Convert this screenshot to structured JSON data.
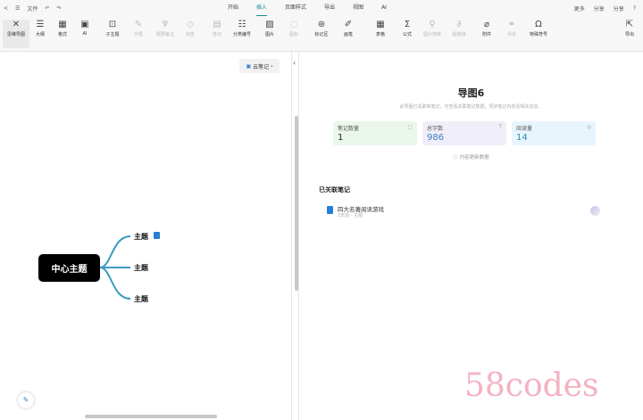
{
  "menubar": {
    "back": "<",
    "menu": "☰",
    "file": "文件",
    "undo": "↶",
    "redo": "↷",
    "items": [
      "开始",
      "插入",
      "页面样式",
      "导出",
      "视图",
      "AI"
    ],
    "active": 1,
    "right": [
      "更多",
      "分享",
      "分享",
      "?"
    ]
  },
  "toolbar": {
    "tools": [
      "思维导图",
      "大纲",
      "格式",
      "AI",
      "子主题",
      "外框",
      "概要备注",
      "标签",
      "笔记",
      "分类编号",
      "图片",
      "图标",
      "标记区",
      "画笔",
      "表格",
      "公式",
      "图片搜索",
      "超链接",
      "附件",
      "评论",
      "特殊符号",
      "导出"
    ],
    "icons": [
      "✕",
      "☰",
      "▦",
      "▣",
      "⊡",
      "✎",
      "♆",
      "◇",
      "▤",
      "☷",
      "▨",
      "◌",
      "⊛",
      "✐",
      "▦",
      "Σ",
      "⚲",
      "∂",
      "⌀",
      "⚭",
      "Ω",
      "⇱"
    ]
  },
  "left": {
    "cloud_button": "云笔记",
    "center_topic": "中心主题",
    "topics": [
      "主题",
      "主题",
      "主题"
    ]
  },
  "right": {
    "title": "导图6",
    "subtitle": "此导图已关联到笔记，可查看关联笔记数据，同步笔记内容及相关信息。",
    "cards": [
      {
        "label": "笔记数量",
        "value": "1",
        "bg": "#eaf7ea"
      },
      {
        "label": "总字数",
        "value": "986",
        "bg": "#f0eef9"
      },
      {
        "label": "阅读量",
        "value": "14",
        "bg": "#e9f5fc"
      }
    ],
    "data_note": "内容更新数据",
    "section": "已关联笔记",
    "note": {
      "title": "四大名著阅读游戏",
      "meta": "2天前 · 主题"
    }
  },
  "watermark": "58codes"
}
